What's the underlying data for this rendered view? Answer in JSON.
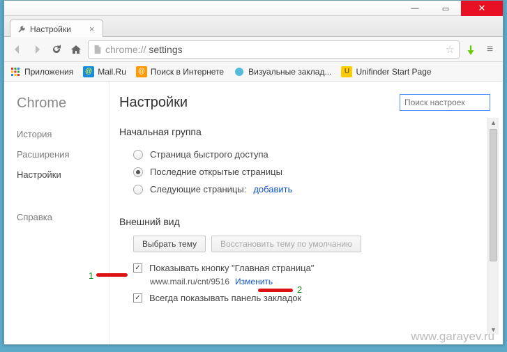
{
  "window": {
    "tab_title": "Настройки",
    "min": "—",
    "max": "▭",
    "close": "✕"
  },
  "address": {
    "scheme_host": "chrome://",
    "path": "settings"
  },
  "bookmarks": {
    "apps": "Приложения",
    "mailru": "Mail.Ru",
    "search": "Поиск в Интернете",
    "visual": "Визуальные заклад...",
    "unifinder": "Unifinder Start Page"
  },
  "sidebar": {
    "brand": "Chrome",
    "history": "История",
    "extensions": "Расширения",
    "settings": "Настройки",
    "help": "Справка"
  },
  "main": {
    "title": "Настройки",
    "search_placeholder": "Поиск настроек",
    "startup": {
      "title": "Начальная группа",
      "opt_quick": "Страница быстрого доступа",
      "opt_last": "Последние открытые страницы",
      "opt_pages": "Следующие страницы:",
      "add_link": "добавить"
    },
    "appearance": {
      "title": "Внешний вид",
      "choose_theme": "Выбрать тему",
      "reset_theme": "Восстановить тему по умолчанию",
      "show_home": "Показывать кнопку \"Главная страница\"",
      "home_url": "www.mail.ru/cnt/9516",
      "change_link": "Изменить",
      "show_bookmarks": "Всегда показывать панель закладок"
    }
  },
  "annotations": {
    "one": "1",
    "two": "2"
  },
  "watermark": "www.garayev.ru"
}
